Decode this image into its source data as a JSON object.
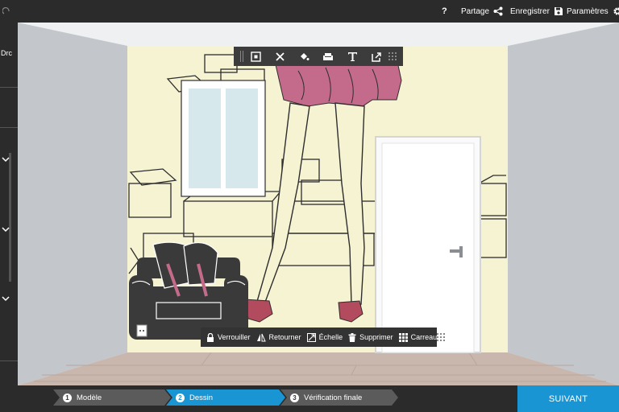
{
  "topbar": {
    "help_label": "?",
    "share_label": "Partage",
    "save_label": "Enregistrer",
    "settings_label": "Paramètres"
  },
  "sidebar": {
    "label": "Drc"
  },
  "toolbar": {
    "tools": [
      "frame-tool",
      "crop-tool",
      "fill-tool",
      "furniture-tool",
      "text-tool",
      "export-tool"
    ]
  },
  "actionbar": {
    "lock_label": "Verrouiller",
    "flip_label": "Retourner",
    "scale_label": "Échelle",
    "delete_label": "Supprimer",
    "tile_label": "Carreau"
  },
  "steps": [
    {
      "number": "1",
      "label": "Modèle",
      "state": "done"
    },
    {
      "number": "2",
      "label": "Dessin",
      "state": "active"
    },
    {
      "number": "3",
      "label": "Vérification finale",
      "state": "pending"
    }
  ],
  "next_label": "SUIVANT",
  "colors": {
    "accent": "#1a95d3",
    "bar": "#2b2b2b",
    "mural_bg": "#f6f3d3",
    "skirt": "#c46b8b",
    "shoes": "#b34b5f"
  }
}
